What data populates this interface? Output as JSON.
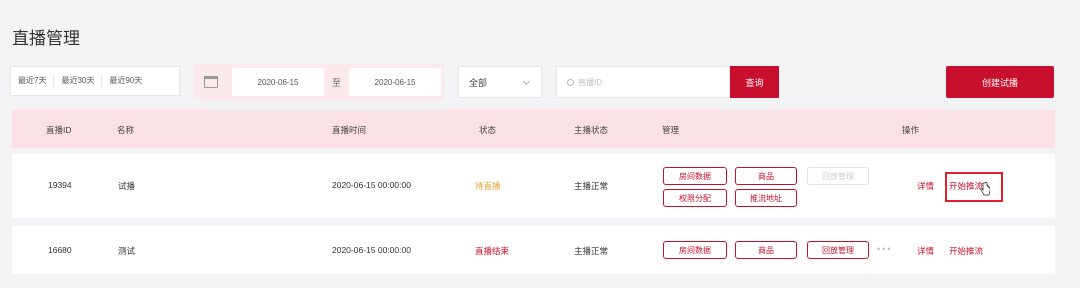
{
  "page_title": "直播管理",
  "quick_ranges": [
    "最近7天",
    "最近30天",
    "最近90天"
  ],
  "date_range": {
    "start": "2020-06-15",
    "separator": "至",
    "end": "2020-06-15"
  },
  "status_filter": {
    "selected": "全部"
  },
  "search": {
    "placeholder": "直播ID",
    "button": "查询"
  },
  "create_button": "创建试播",
  "columns": [
    "直播ID",
    "名称",
    "直播时间",
    "状态",
    "主播状态",
    "管理",
    "操作"
  ],
  "rows": [
    {
      "id": "19394",
      "name": "试播",
      "time": "2020-06-15 00:00:00",
      "status": "待直播",
      "anchor_status": "主播正常",
      "manage": [
        "房间数据",
        "商品",
        "回放管理",
        "权限分配",
        "推流地址"
      ],
      "actions": [
        "详情",
        "开始推流"
      ]
    },
    {
      "id": "16680",
      "name": "测试",
      "time": "2020-06-15 00:00:00",
      "status": "直播结束",
      "anchor_status": "主播正常",
      "manage": [
        "房间数据",
        "商品",
        "回放管理"
      ],
      "more": "•••",
      "actions": [
        "详情",
        "开始推流"
      ]
    }
  ],
  "colors": {
    "accent": "#c8102e",
    "header_bg": "#fbe1e5",
    "status_wait": "#e8a13a"
  }
}
